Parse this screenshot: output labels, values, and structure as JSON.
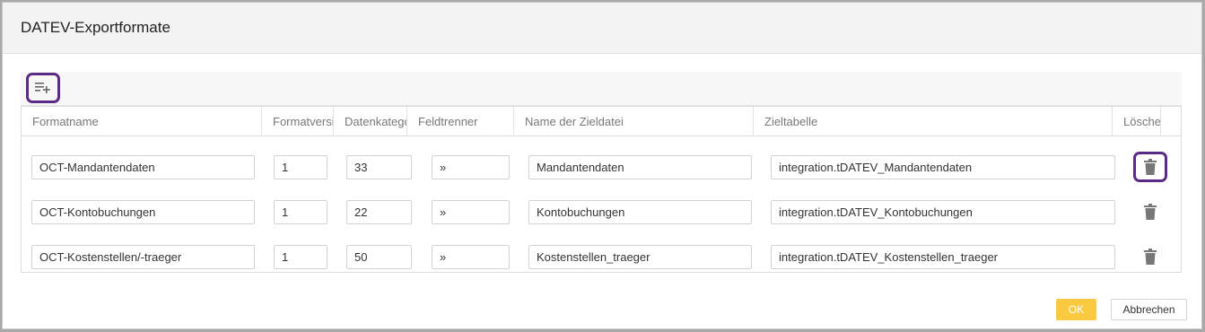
{
  "dialog": {
    "title": "DATEV-Exportformate"
  },
  "toolbar": {
    "add_icon": "playlist-add-icon"
  },
  "grid": {
    "columns": [
      {
        "label": "Formatname"
      },
      {
        "label": "Formatversion"
      },
      {
        "label": "Datenkategorie"
      },
      {
        "label": "Feldtrenner"
      },
      {
        "label": "Name der Zieldatei"
      },
      {
        "label": "Zieltabelle"
      },
      {
        "label": "Löschen"
      }
    ],
    "rows": [
      {
        "name": "OCT-Mandantendaten",
        "version": "1",
        "category": "33",
        "separator": "»",
        "file": "Mandantendaten",
        "table": "integration.tDATEV_Mandantendaten"
      },
      {
        "name": "OCT-Kontobuchungen",
        "version": "1",
        "category": "22",
        "separator": "»",
        "file": "Kontobuchungen",
        "table": "integration.tDATEV_Kontobuchungen"
      },
      {
        "name": "OCT-Kostenstellen/-traeger",
        "version": "1",
        "category": "50",
        "separator": "»",
        "file": "Kostenstellen_traeger",
        "table": "integration.tDATEV_Kostenstellen_traeger"
      }
    ],
    "delete_icon": "trash-icon"
  },
  "footer": {
    "ok_label": "OK",
    "cancel_label": "Abbrechen"
  },
  "colors": {
    "accent": "#f9c940",
    "highlight": "#5b2a86"
  }
}
